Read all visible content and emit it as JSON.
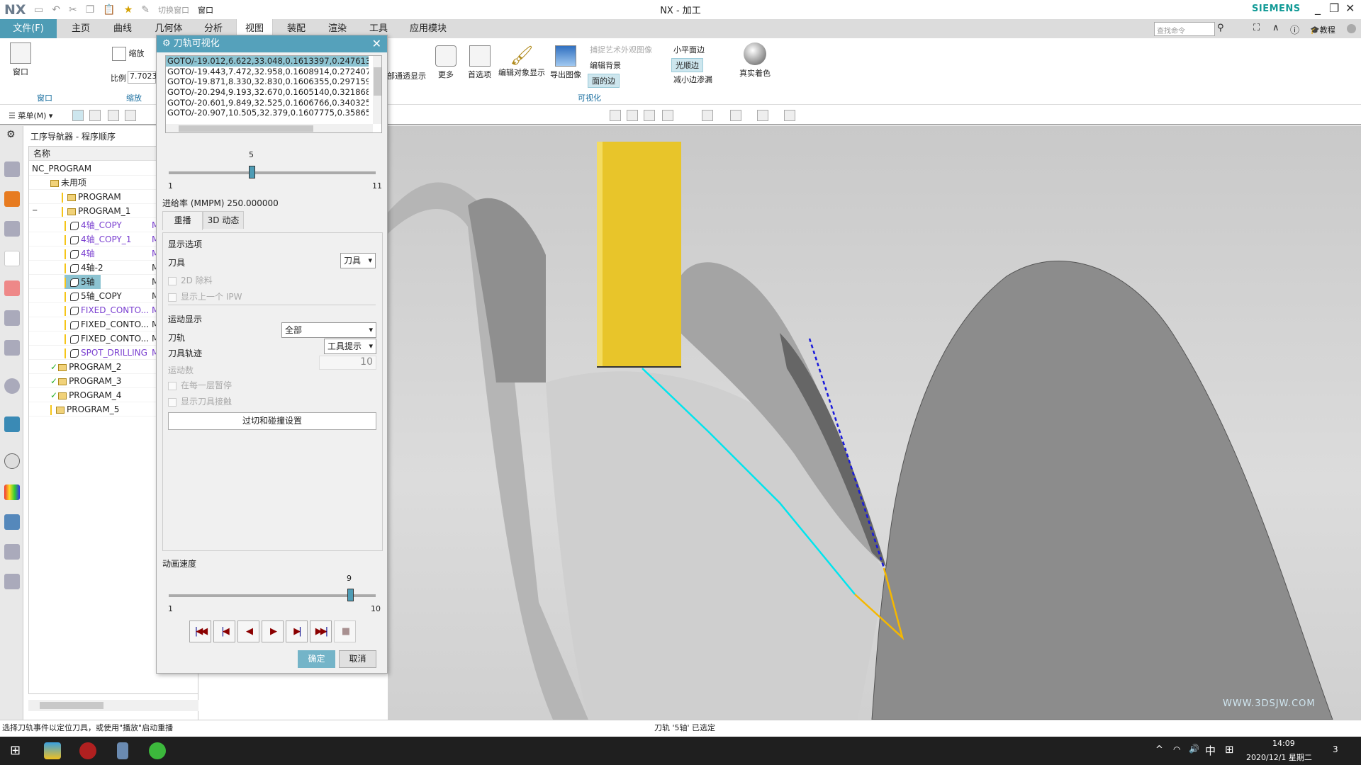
{
  "app": {
    "logo": "NX",
    "title": "NX - 加工",
    "brand": "SIEMENS",
    "quick_access": [
      "切换窗口",
      "窗口"
    ]
  },
  "menu": {
    "tabs": [
      "文件(F)",
      "主页",
      "曲线",
      "几何体",
      "分析",
      "视图",
      "装配",
      "渲染",
      "工具",
      "应用模块"
    ],
    "active": "视图",
    "search_placeholder": "查找命令",
    "tutorial": "教程"
  },
  "ribbon": {
    "window_group": {
      "label": "窗口",
      "button": "窗口"
    },
    "zoom_group": {
      "label": "缩放",
      "zoom": "缩放",
      "scale_label": "比例",
      "scale_value": "7.7023"
    },
    "transparency": "部通透显示",
    "more": "更多",
    "visual_group": {
      "label": "可视化",
      "items": [
        "首选项",
        "编辑对象显示",
        "导出图像",
        "捕捉艺术外观图像",
        "编辑背景",
        "面的边",
        "小平面边",
        "光顺边",
        "减小边渗漏",
        "真实着色"
      ]
    }
  },
  "toolbar": {
    "menu": "菜单(M)"
  },
  "navigator": {
    "title": "工序导航器 - 程序顺序",
    "column": "名称",
    "rows": [
      {
        "name": "NC_PROGRAM",
        "type": "root"
      },
      {
        "name": "未用项",
        "type": "folder"
      },
      {
        "name": "PROGRAM",
        "type": "folder"
      },
      {
        "name": "PROGRAM_1",
        "type": "folder",
        "expanded": true
      },
      {
        "name": "4轴_COPY",
        "type": "op",
        "color": "purple",
        "col2": "M"
      },
      {
        "name": "4轴_COPY_1",
        "type": "op",
        "color": "purple",
        "col2": "M"
      },
      {
        "name": "4轴",
        "type": "op",
        "color": "purple",
        "col2": "M"
      },
      {
        "name": "4轴-2",
        "type": "op",
        "col2": "M"
      },
      {
        "name": "5轴",
        "type": "op",
        "selected": true,
        "col2": "M"
      },
      {
        "name": "5轴_COPY",
        "type": "op",
        "col2": "M"
      },
      {
        "name": "FIXED_CONTO...",
        "type": "op",
        "color": "purple",
        "col2": "M"
      },
      {
        "name": "FIXED_CONTO...",
        "type": "op",
        "col2": "M"
      },
      {
        "name": "FIXED_CONTO...",
        "type": "op",
        "col2": "M"
      },
      {
        "name": "SPOT_DRILLING",
        "type": "op",
        "color": "purple",
        "col2": "M"
      },
      {
        "name": "PROGRAM_2",
        "type": "folder",
        "checked": true
      },
      {
        "name": "PROGRAM_3",
        "type": "folder",
        "checked": true
      },
      {
        "name": "PROGRAM_4",
        "type": "folder",
        "checked": true
      },
      {
        "name": "PROGRAM_5",
        "type": "folder"
      }
    ]
  },
  "dialog": {
    "title": "刀轨可视化",
    "goto_list": [
      "GOTO/-19.012,6.622,33.048,0.1613397,0.2476130,",
      "GOTO/-19.443,7.472,32.958,0.1608914,0.2724077,",
      "GOTO/-19.871,8.330,32.830,0.1606355,0.2971598,",
      "GOTO/-20.294,9.193,32.670,0.1605140,0.3218684,",
      "GOTO/-20.601,9.849,32.525,0.1606766,0.3403256,",
      "GOTO/-20.907,10.505,32.379,0.1607775,0.358651"
    ],
    "position_slider": {
      "value": "5",
      "min": "1",
      "max": "11",
      "fraction": 0.4
    },
    "feed_rate": "进给率 (MMPM) 250.000000",
    "tabs": [
      "重播",
      "3D 动态"
    ],
    "display_options": "显示选项",
    "tool_label": "刀具",
    "tool_value": "刀具",
    "cb_2d": "2D 除料",
    "cb_ipw": "显示上一个 IPW",
    "motion_display": "运动显示",
    "path_label": "刀轨",
    "path_value": "全部",
    "trace_label": "刀具轨迹",
    "trace_value": "工具提示",
    "motion_count_label": "运动数",
    "motion_count_value": "10",
    "cb_pause": "在每一层暂停",
    "cb_contact": "显示刀具接触",
    "gouge_button": "过切和碰撞设置",
    "speed_label": "动画速度",
    "speed_slider": {
      "value": "9",
      "min": "1",
      "max": "10",
      "fraction": 0.889
    },
    "ok": "确定",
    "cancel": "取消"
  },
  "status": {
    "left": "选择刀轨事件以定位刀具，或使用\"播放\"启动重播",
    "center": "刀轨 '5轴' 已选定"
  },
  "taskbar": {
    "ime": "中",
    "time": "14:09",
    "date": "2020/12/1 星期二",
    "notif": "3"
  },
  "watermark": "WWW.3DSJW.COM",
  "colors": {
    "accent": "#4e9cb5",
    "tool": "#e8c52a",
    "toolpath": "#00e5ee",
    "tool_axis": "#1a1adc",
    "tool_tip": "#f5b800"
  }
}
